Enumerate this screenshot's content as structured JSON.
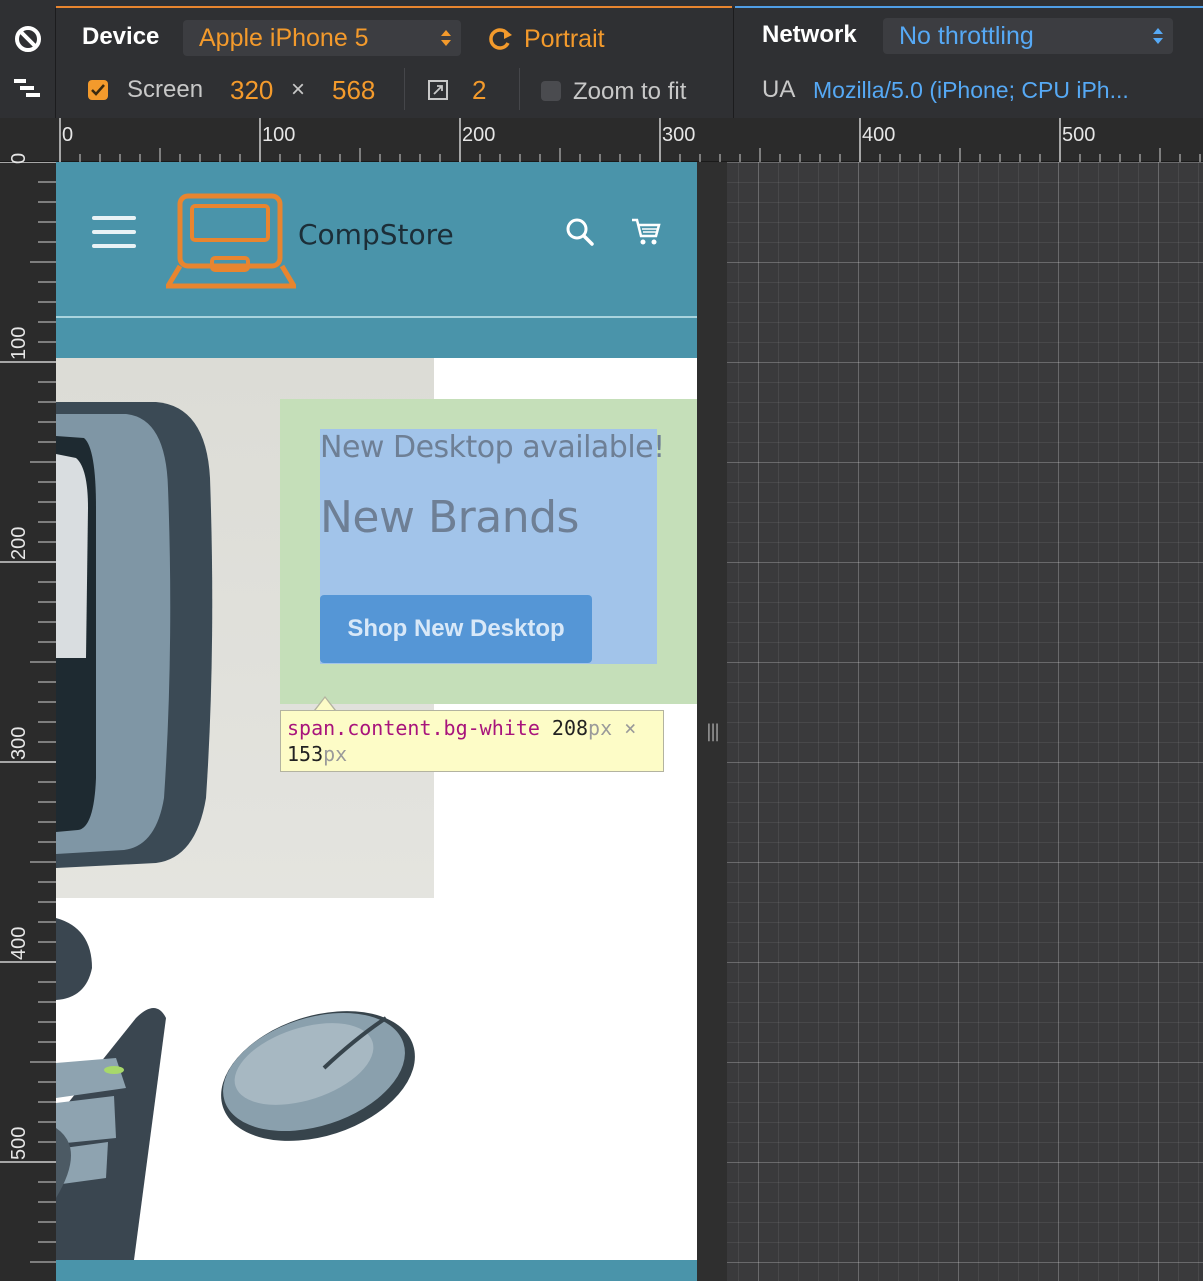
{
  "toolbar": {
    "device_label": "Device",
    "device_value": "Apple iPhone 5",
    "orientation_label": "Portrait",
    "screen_label": "Screen",
    "screen_width": "320",
    "screen_times": "×",
    "screen_height": "568",
    "pixel_ratio": "2",
    "zoom_to_fit_label": "Zoom to fit",
    "screen_checked": true,
    "zoom_to_fit_checked": false,
    "network_label": "Network",
    "network_value": "No throttling",
    "ua_label": "UA",
    "ua_value": "Mozilla/5.0 (iPhone; CPU iPh..."
  },
  "ruler": {
    "h_labels": [
      "0",
      "100",
      "200",
      "300",
      "400",
      "500"
    ],
    "v_labels": [
      "0",
      "100",
      "200",
      "300",
      "400",
      "500"
    ]
  },
  "site": {
    "brand": "CompStore",
    "promo_small": "New Desktop available!",
    "promo_big": "New Brands",
    "cta": "Shop New Desktop"
  },
  "tooltip": {
    "selector": "span.content.bg-white",
    "width": "208",
    "height": "153",
    "unit": "px",
    "times": "×"
  },
  "colors": {
    "accent_orange": "#f39a2c",
    "accent_blue": "#56a9f5",
    "site_header": "#4a94aa",
    "promo_outer": "#c5dfb9",
    "promo_inner": "#a2c4ea",
    "cta_button": "#5596d6"
  },
  "icons": {
    "toolbar": [
      "no-entry-icon",
      "media-query-icon",
      "rotate-icon",
      "pixel-ratio-icon",
      "select-arrows-icon"
    ],
    "site": [
      "hamburger-menu-icon",
      "laptop-logo-icon",
      "search-icon",
      "cart-icon"
    ]
  }
}
